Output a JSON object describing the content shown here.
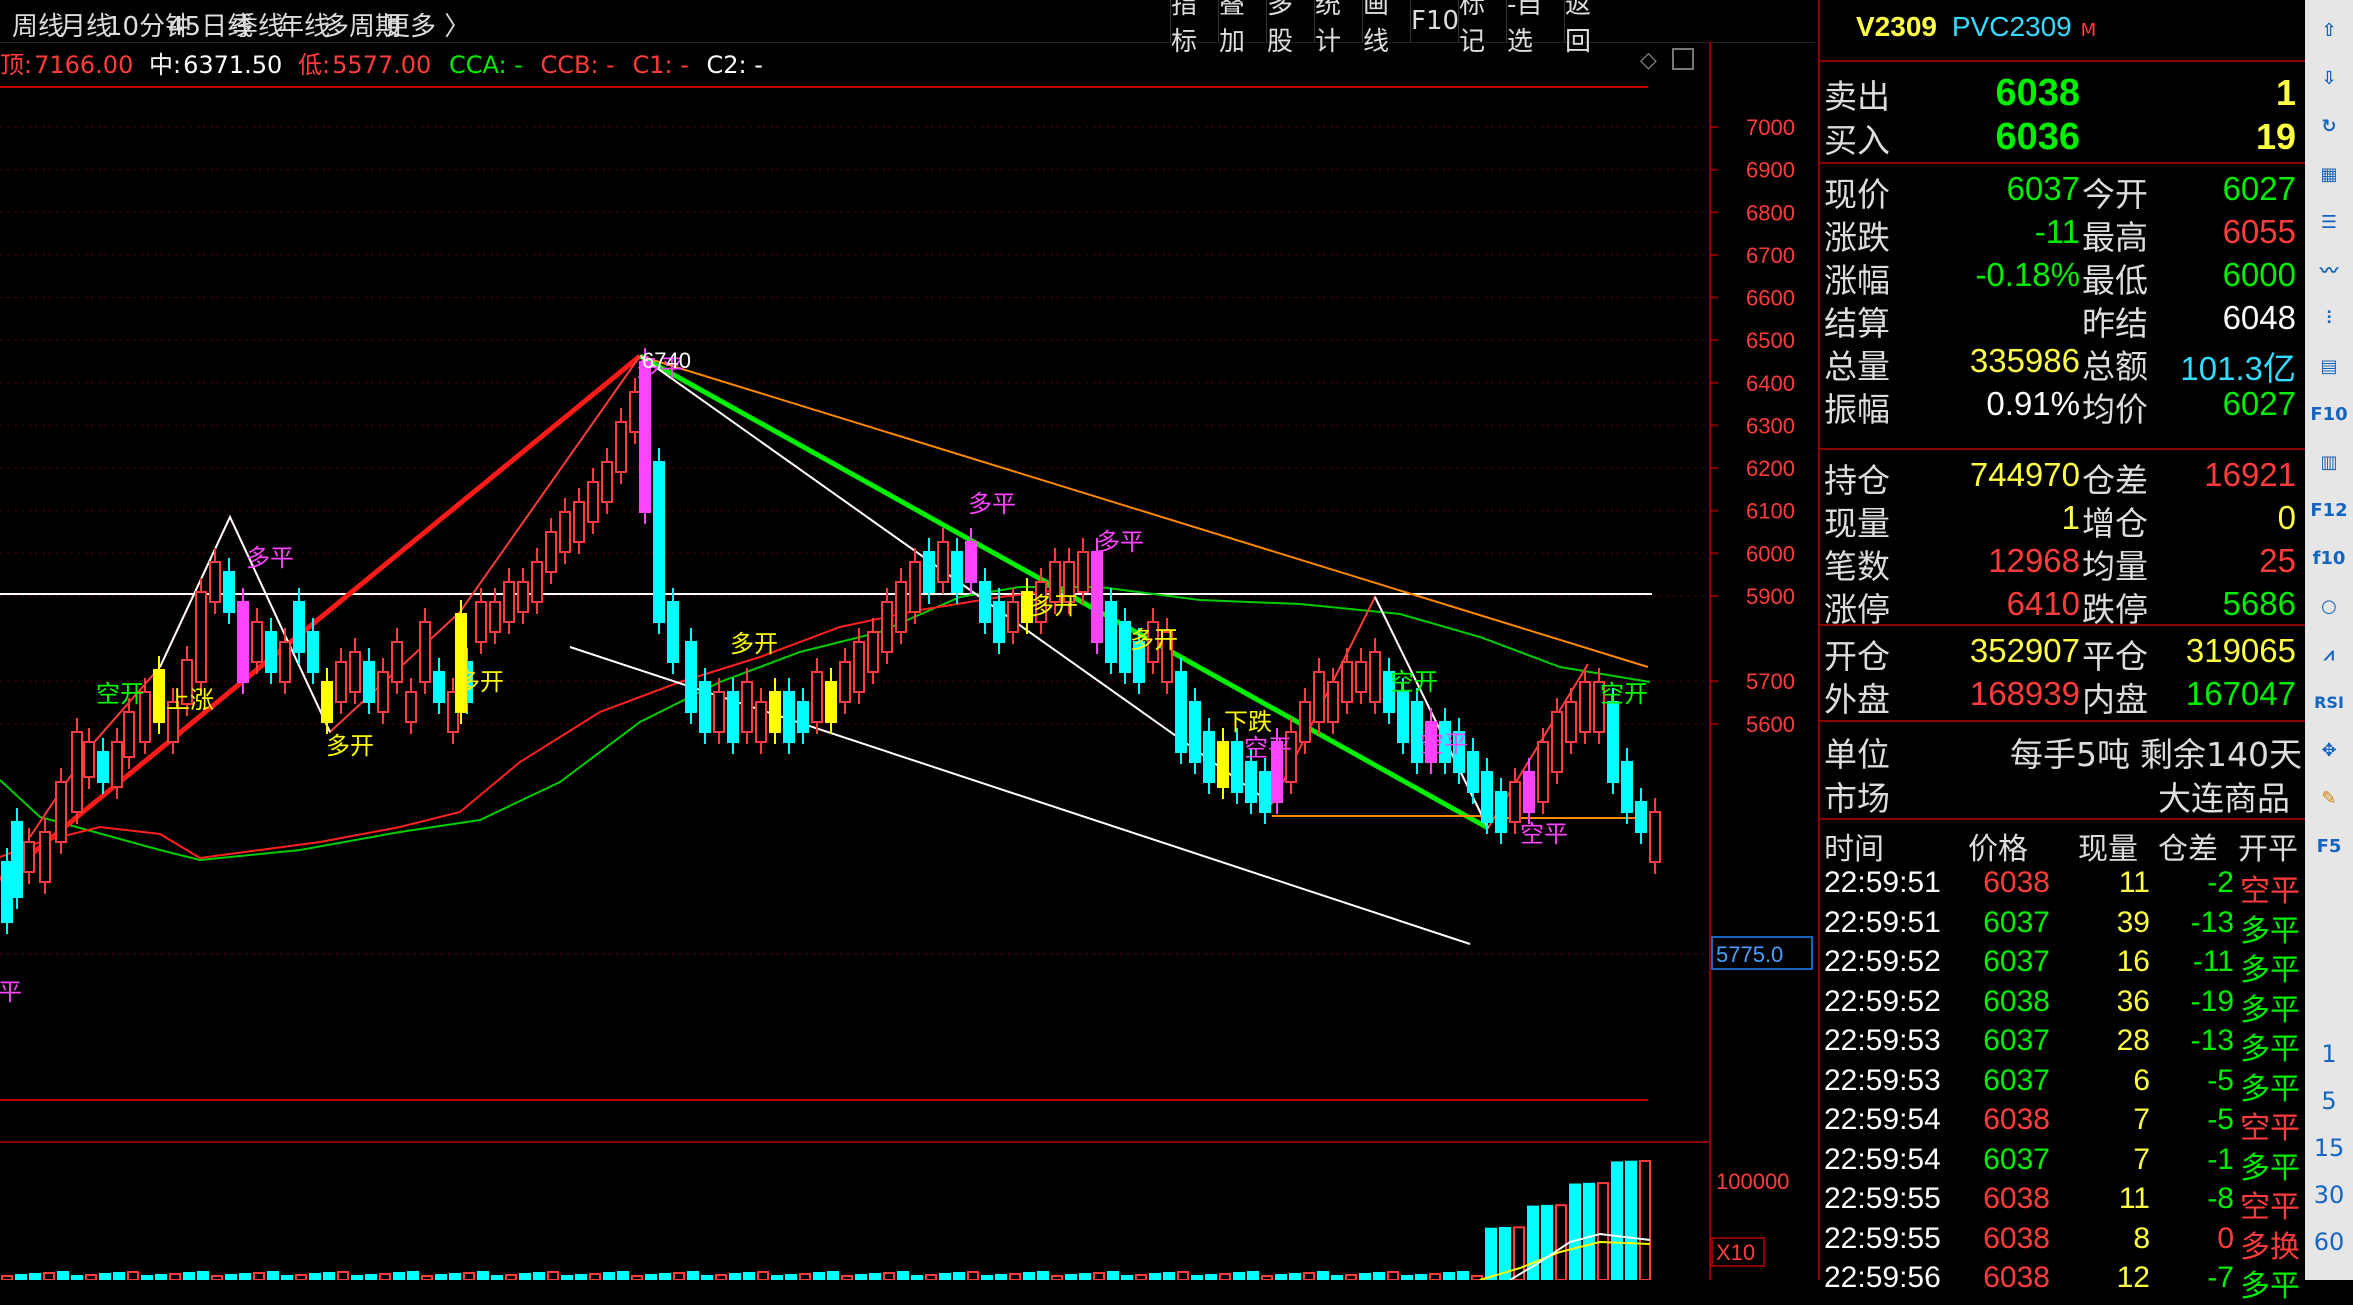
{
  "toolbar": {
    "left_items": [
      "周线",
      "月线",
      "10分钟",
      "45日线",
      "季线",
      "年线",
      "多周期",
      "更多 〉"
    ],
    "right_items": [
      "指标",
      "叠加",
      "多股",
      "统计",
      "画线",
      "F10",
      "标记",
      "-自选",
      "返回"
    ]
  },
  "infoline": {
    "top_label": "顶:",
    "top_value": "7166.00",
    "mid_label": "中:",
    "mid_value": "6371.50",
    "low_label": "低:",
    "low_value": "5577.00",
    "cca": "CCA: -",
    "ccb": "CCB: -",
    "c1": "C1: -",
    "c2": "C2: -"
  },
  "chart": {
    "y_ticks": [
      "7000",
      "6900",
      "6800",
      "6700",
      "6600",
      "6500",
      "6400",
      "6300",
      "6200",
      "6100",
      "6000",
      "5900",
      "5700",
      "5600"
    ],
    "price_tag": "5775.0",
    "high_label": "6740",
    "vol_tick": "100000",
    "vol_unit": "X10",
    "annotations": [
      {
        "text": "平",
        "color": "#ff44ff"
      },
      {
        "text": "空开",
        "color": "#00ff00"
      },
      {
        "text": "上涨",
        "color": "#ffff00"
      },
      {
        "text": "多平",
        "color": "#ff44ff"
      },
      {
        "text": "多开",
        "color": "#ffff00"
      },
      {
        "text": "多开",
        "color": "#ffff00"
      },
      {
        "text": "多平",
        "color": "#ff44ff"
      },
      {
        "text": "多开",
        "color": "#ffff00"
      },
      {
        "text": "多平",
        "color": "#ff44ff"
      },
      {
        "text": "多开",
        "color": "#ffff00"
      },
      {
        "text": "多平",
        "color": "#ff44ff"
      },
      {
        "text": "多开",
        "color": "#ffff00"
      },
      {
        "text": "下跌",
        "color": "#ffff00"
      },
      {
        "text": "空平",
        "color": "#ff44ff"
      },
      {
        "text": "空开",
        "color": "#00ff00"
      },
      {
        "text": "空平",
        "color": "#ff44ff"
      },
      {
        "text": "空平",
        "color": "#ff44ff"
      },
      {
        "text": "空开",
        "color": "#00ff00"
      }
    ]
  },
  "panel": {
    "code": "V2309",
    "name": "PVC2309",
    "badge": "M",
    "sell_label": "卖出",
    "sell_price": "6038",
    "sell_vol": "1",
    "buy_label": "买入",
    "buy_price": "6036",
    "buy_vol": "19",
    "stats": [
      {
        "l1": "现价",
        "v1": "6037",
        "c1": "#00ee00",
        "l2": "今开",
        "v2": "6027",
        "c2": "#00ee00"
      },
      {
        "l1": "涨跌",
        "v1": "-11",
        "c1": "#00ee00",
        "l2": "最高",
        "v2": "6055",
        "c2": "#ff3b3b"
      },
      {
        "l1": "涨幅",
        "v1": "-0.18%",
        "c1": "#00ee00",
        "l2": "最低",
        "v2": "6000",
        "c2": "#00ee00"
      },
      {
        "l1": "结算",
        "v1": "",
        "c1": "#ffffff",
        "l2": "昨结",
        "v2": "6048",
        "c2": "#ffffff"
      },
      {
        "l1": "总量",
        "v1": "335986",
        "c1": "#ffff44",
        "l2": "总额",
        "v2": "101.3亿",
        "c2": "#33ddff"
      },
      {
        "l1": "振幅",
        "v1": "0.91%",
        "c1": "#ffffff",
        "l2": "均价",
        "v2": "6027",
        "c2": "#00ee00"
      }
    ],
    "stats2": [
      {
        "l1": "持仓",
        "v1": "744970",
        "c1": "#ffff44",
        "l2": "仓差",
        "v2": "16921",
        "c2": "#ff3b3b"
      },
      {
        "l1": "现量",
        "v1": "1",
        "c1": "#ffff44",
        "l2": "增仓",
        "v2": "0",
        "c2": "#ffff44"
      },
      {
        "l1": "笔数",
        "v1": "12968",
        "c1": "#ff3b3b",
        "l2": "均量",
        "v2": "25",
        "c2": "#ff3b3b"
      },
      {
        "l1": "涨停",
        "v1": "6410",
        "c1": "#ff3b3b",
        "l2": "跌停",
        "v2": "5686",
        "c2": "#00ee00"
      }
    ],
    "stats3": [
      {
        "l1": "开仓",
        "v1": "352907",
        "c1": "#ffff44",
        "l2": "平仓",
        "v2": "319065",
        "c2": "#ffff44"
      },
      {
        "l1": "外盘",
        "v1": "168939",
        "c1": "#ff3b3b",
        "l2": "内盘",
        "v2": "167047",
        "c2": "#00ee00"
      }
    ],
    "unit_label": "单位",
    "unit_value": "每手5吨",
    "remain": "剩余140天",
    "market_label": "市场",
    "market_value": "大连商品",
    "trade_headers": [
      "时间",
      "价格",
      "现量",
      "仓差",
      "开平"
    ],
    "trades": [
      {
        "time": "22:59:51",
        "price": "6038",
        "vol": "11",
        "diff": "-2",
        "type": "空平",
        "pc": "#ff3b3b",
        "tc": "#ff3b3b"
      },
      {
        "time": "22:59:51",
        "price": "6037",
        "vol": "39",
        "diff": "-13",
        "type": "多平",
        "pc": "#00ee00",
        "tc": "#00ee00"
      },
      {
        "time": "22:59:52",
        "price": "6037",
        "vol": "16",
        "diff": "-11",
        "type": "多平",
        "pc": "#00ee00",
        "tc": "#00ee00"
      },
      {
        "time": "22:59:52",
        "price": "6038",
        "vol": "36",
        "diff": "-19",
        "type": "多平",
        "pc": "#00ee00",
        "tc": "#00ee00"
      },
      {
        "time": "22:59:53",
        "price": "6037",
        "vol": "28",
        "diff": "-13",
        "type": "多平",
        "pc": "#00ee00",
        "tc": "#00ee00"
      },
      {
        "time": "22:59:53",
        "price": "6037",
        "vol": "6",
        "diff": "-5",
        "type": "多平",
        "pc": "#00ee00",
        "tc": "#00ee00"
      },
      {
        "time": "22:59:54",
        "price": "6038",
        "vol": "7",
        "diff": "-5",
        "type": "空平",
        "pc": "#ff3b3b",
        "tc": "#ff3b3b"
      },
      {
        "time": "22:59:54",
        "price": "6037",
        "vol": "7",
        "diff": "-1",
        "type": "多平",
        "pc": "#00ee00",
        "tc": "#00ee00"
      },
      {
        "time": "22:59:55",
        "price": "6038",
        "vol": "11",
        "diff": "-8",
        "type": "空平",
        "pc": "#ff3b3b",
        "tc": "#ff3b3b"
      },
      {
        "time": "22:59:55",
        "price": "6038",
        "vol": "8",
        "diff": "0",
        "type": "多换",
        "pc": "#ff3b3b",
        "tc": "#ff3b3b"
      },
      {
        "time": "22:59:56",
        "price": "6038",
        "vol": "12",
        "diff": "-7",
        "type": "多平",
        "pc": "#ff3b3b",
        "tc": "#00ee00"
      }
    ]
  },
  "sidebar": {
    "icons": [
      "up-arrow-icon",
      "down-arrow-icon",
      "refresh-icon",
      "table-icon",
      "list-icon",
      "line-chart-icon",
      "candle-chart-icon",
      "report-icon",
      "f10-icon",
      "grid-icon",
      "f12-icon",
      "f10b-icon",
      "circle-icon",
      "kline-icon",
      "rsi-icon",
      "move-icon",
      "pencil-icon",
      "f5-icon"
    ],
    "icon_text": [
      "⇧",
      "⇩",
      "↻",
      "▦",
      "☰",
      "〰",
      "⫶",
      "▤",
      "F10",
      "▥",
      "F12",
      "f10",
      "○",
      "⩘",
      "RSI",
      "✥",
      "✎",
      "F5"
    ],
    "periods": [
      "1",
      "5",
      "15",
      "30",
      "60"
    ]
  },
  "colors": {
    "up": "#ff3b3b",
    "down": "#00ee00",
    "frame": "#8a0000",
    "highlight_yellow": "#ffff00",
    "highlight_magenta": "#ff44ff"
  }
}
